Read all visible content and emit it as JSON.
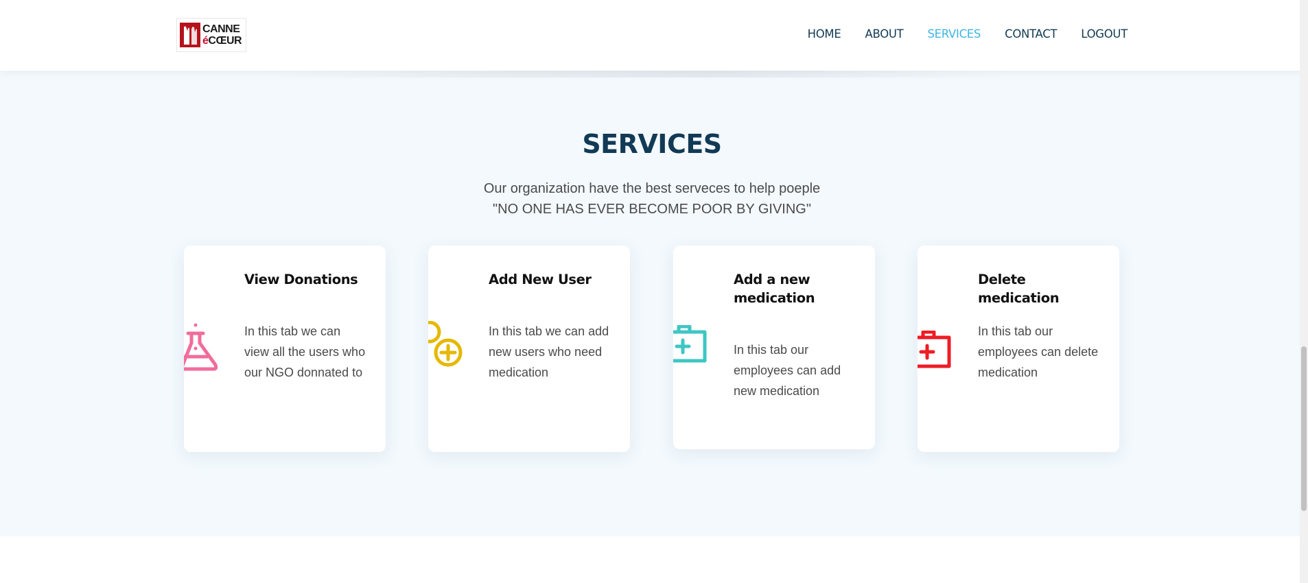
{
  "brand": {
    "logo_line1": "CANNE",
    "logo_line2_accent": "é",
    "logo_line2": "CŒUR"
  },
  "nav": {
    "items": [
      {
        "label": "HOME",
        "active": false
      },
      {
        "label": "ABOUT",
        "active": false
      },
      {
        "label": "SERVICES",
        "active": true
      },
      {
        "label": "CONTACT",
        "active": false
      },
      {
        "label": "LOGOUT",
        "active": false
      }
    ]
  },
  "section": {
    "title": "SERVICES",
    "subtitle_line1": "Our organization have the best serveces to help poeple",
    "subtitle_line2": "\"NO ONE HAS EVER BECOME POOR BY GIVING\""
  },
  "cards": [
    {
      "title": "View Donations",
      "description": "In this tab we can view all the users who our NGO donnated to",
      "icon": "flask-icon",
      "color": "#f06d9b"
    },
    {
      "title": "Add New User",
      "description": "In this tab we can add new users who need medication",
      "icon": "add-user-icon",
      "color": "#e6b800"
    },
    {
      "title": "Add a new medication",
      "description": "In this tab our employees can add new medication",
      "icon": "medical-kit-icon",
      "color": "#3ec6c3"
    },
    {
      "title": "Delete medication",
      "description": "In this tab our employees can delete medication",
      "icon": "medical-kit-icon",
      "color": "#ee1c25"
    }
  ],
  "colors": {
    "navy": "#123a55",
    "accent": "#3fb6e3",
    "section_bg": "#f3f9fd"
  }
}
